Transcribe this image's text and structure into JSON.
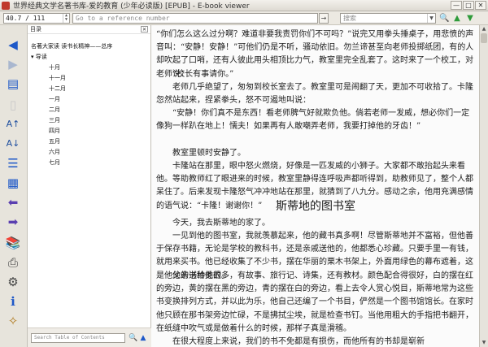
{
  "window": {
    "title": "世界经典文学名著书库-爱的教育 (少年必读版) [EPUB] - E-book viewer",
    "buttons": [
      "—",
      "□",
      "✕"
    ]
  },
  "toolbar": {
    "page_value": "40.7 / 111",
    "reference_placeholder": "Go to a reference number",
    "reference_go": "→",
    "search_placeholder": "搜索"
  },
  "toc": {
    "header": "目录",
    "close": "✕",
    "items": [
      "名著大家读  读书长精神——总序",
      "导读",
      "十月",
      "十一月",
      "十二月",
      "一月",
      "二月",
      "三月",
      "四月",
      "五月",
      "六月",
      "七月"
    ],
    "search_placeholder": "Search Table of Contents"
  },
  "reader": {
    "paragraphs": [
      "“你们怎么这么过分啊？难道非要我责罚你们不可吗？”说完又用拳头捶桌子，用悲愤的声音叫：“安静！安静！”可他们仍是不听，骚动依旧。勿兰谛甚至向老师投掷纸团，有的人却吹起了口哨，还有人彼此用头相顶比力气，教室里完全乱套了。这时来了一个校工，对老师说：",
      "“校长有事请你。”",
      "老师几乎绝望了，匆匆到校长室去了。教室里可是闹翻了天，更加不可收拾了。卡隆忽然站起来，捏紧拳头，怒不可遏地叫说：",
      "“安静！你们真不是东西！看老师脾气好就欺负他。倘若老师一发威，想必你们一定像狗一样趴在地上！懦夫！如果再有人敢嘲弄老师，我要打掉他的牙齿！”",
      "教室里顿时安静了。",
      "卡隆站在那里，眼中怒火燃烧，好像是一匹发威的小狮子。大家都不敢抬起头来看他。等助教师红了眼进来的时候，教室里静得连呼吸声都听得到，助教师见了，整个人都呆住了。后来发现卡隆怒气冲冲地站在那里，就猜到了八九分。感动之余，他用充满感情的语气说：“卡隆！谢谢你！”"
    ],
    "chapter_title": "斯蒂地的图书室",
    "chapter_paragraphs": [
      "今天，我去斯蒂地的家了。",
      "一见到他的图书室，我就羡慕起来，他的藏书真多啊！尽管斯蒂地并不富裕，但他善于保存书籍，无论是学校的教科书，还是亲戚送他的，他都悉心珍藏。只要手里一有钱，就用来买书。他已经收集了不少书，摆在华丽的栗木书架上，外面用绿色的幕布遮着，这是他父亲送给他的。",
      "他的书种类很多，有故事、旅行记、诗集，还有教材。颜色配合得很好，白的摆在红的旁边，黄的摆在黑的旁边，青的摆在白的旁边，看上去令人赏心悦目，斯蒂地常为这些书变换排列方式，并以此为乐，他自己还编了一个书目，俨然是一个图书馆馆长。在家时他只顾在那书架旁边忙碌，不是拂拭尘埃，就是检查书钉。当他用粗大的手指把书翻开，在纸缝中吹气或是做着什么的时候，那样子真是滑稽。",
      "在很大程度上来说，我们的书不免都是有损伤，而他所有的书却是崭新"
    ]
  },
  "colors": {
    "accent_blue": "#1e58c8",
    "green_arrow": "#2e9b3a"
  }
}
